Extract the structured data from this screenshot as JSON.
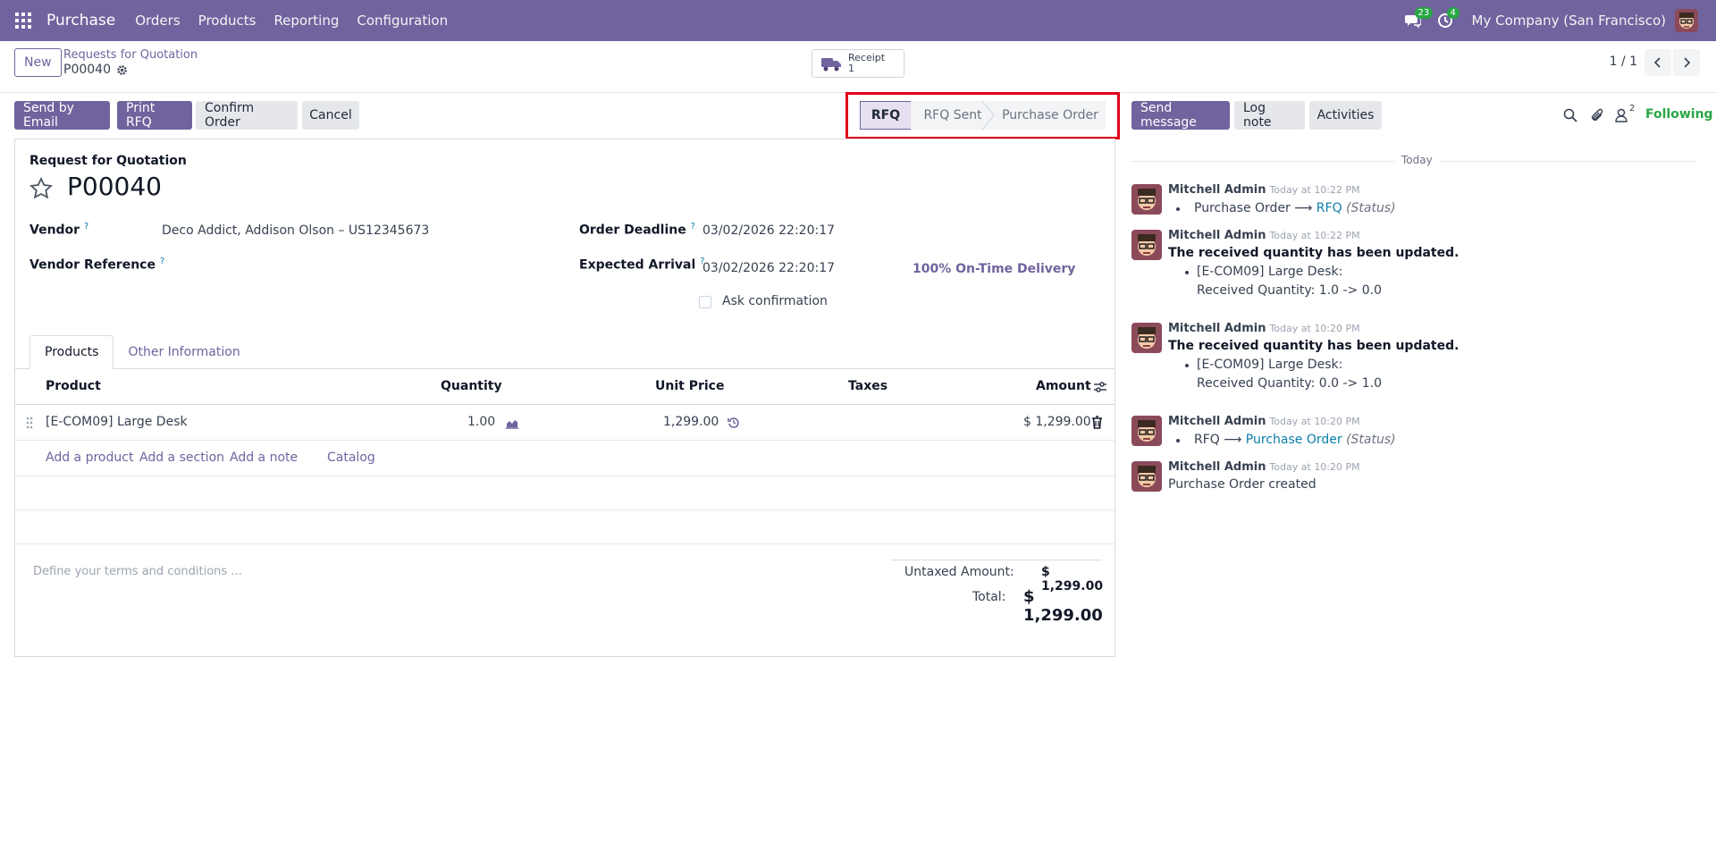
{
  "navbar": {
    "app_name": "Purchase",
    "menu": [
      "Orders",
      "Products",
      "Reporting",
      "Configuration"
    ],
    "messages_count": "23",
    "activities_count": "4",
    "company": "My Company (San Francisco)"
  },
  "control_panel": {
    "new_label": "New",
    "breadcrumb": "Requests for Quotation",
    "record_name": "P00040",
    "smart_button": {
      "label": "Receipt",
      "count": "1"
    },
    "pager": "1 / 1"
  },
  "actions": {
    "send_by_email": "Send by Email",
    "print_rfq": "Print RFQ",
    "confirm_order": "Confirm Order",
    "cancel": "Cancel"
  },
  "statusbar": {
    "steps": [
      "RFQ",
      "RFQ Sent",
      "Purchase Order"
    ],
    "active": "RFQ"
  },
  "form": {
    "title_label": "Request for Quotation",
    "number": "P00040",
    "vendor_label": "Vendor",
    "vendor_value": "Deco Addict, Addison Olson – US12345673",
    "vendor_ref_label": "Vendor Reference",
    "order_deadline_label": "Order Deadline",
    "order_deadline_value": "03/02/2026 22:20:17",
    "expected_arrival_label": "Expected Arrival",
    "expected_arrival_value": "03/02/2026 22:20:17",
    "on_time_delivery": "100% On-Time Delivery",
    "ask_confirmation_label": "Ask confirmation",
    "help_mark": "?",
    "tabs": [
      "Products",
      "Other Information"
    ],
    "table": {
      "headers": [
        "Product",
        "Quantity",
        "Unit Price",
        "Taxes",
        "Amount"
      ],
      "row": {
        "product": "[E-COM09] Large Desk",
        "quantity": "1.00",
        "unit_price": "1,299.00",
        "taxes": "",
        "amount": "$ 1,299.00"
      },
      "add_links": [
        "Add a product",
        "Add a section",
        "Add a note",
        "Catalog"
      ]
    },
    "terms_placeholder": "Define your terms and conditions ...",
    "untaxed_label": "Untaxed Amount:",
    "untaxed_value": "$ 1,299.00",
    "total_label": "Total:",
    "total_value": "$ 1,299.00"
  },
  "chatter": {
    "send_message": "Send message",
    "log_note": "Log note",
    "activities": "Activities",
    "followers_count": "2",
    "following": "Following",
    "today": "Today",
    "messages": [
      {
        "author": "Mitchell Admin",
        "time": "Today at 10:22 PM",
        "from": "Purchase Order",
        "arrow": "⟶",
        "to": "RFQ",
        "field": "(Status)"
      },
      {
        "author": "Mitchell Admin",
        "time": "Today at 10:22 PM",
        "title": "The received quantity has been updated.",
        "item": "[E-COM09] Large Desk:",
        "detail": "Received Quantity: 1.0 -> 0.0"
      },
      {
        "author": "Mitchell Admin",
        "time": "Today at 10:20 PM",
        "title": "The received quantity has been updated.",
        "item": "[E-COM09] Large Desk:",
        "detail": "Received Quantity: 0.0 -> 1.0"
      },
      {
        "author": "Mitchell Admin",
        "time": "Today at 10:20 PM",
        "from": "RFQ",
        "arrow": "⟶",
        "to": "Purchase Order",
        "field": "(Status)"
      },
      {
        "author": "Mitchell Admin",
        "time": "Today at 10:20 PM",
        "body": "Purchase Order created"
      }
    ]
  }
}
